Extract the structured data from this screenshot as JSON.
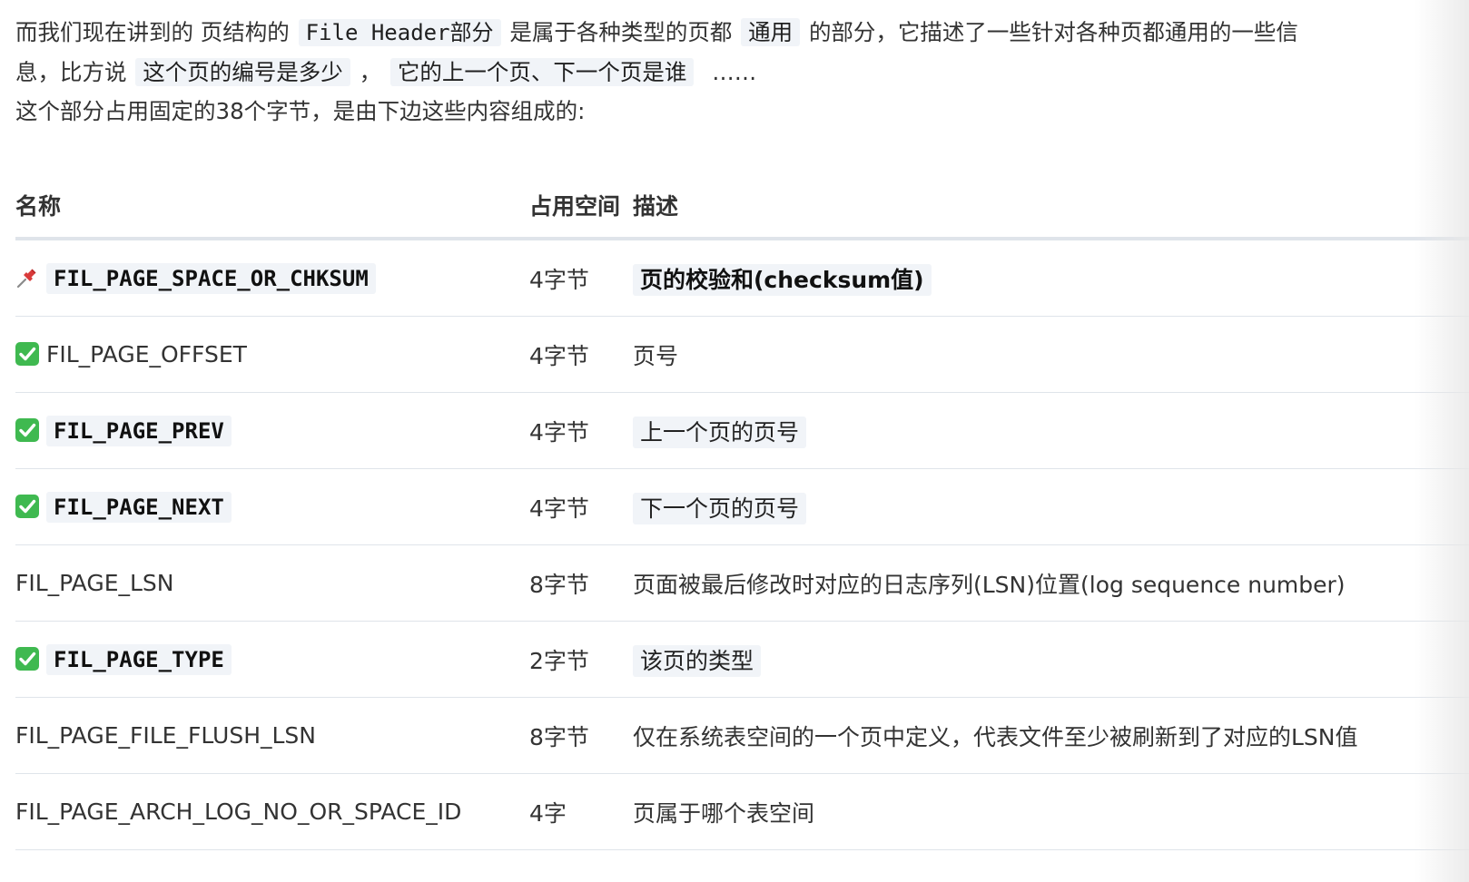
{
  "intro": {
    "line1": {
      "t1": "而我们现在讲到的 页结构的",
      "c1": "File Header部分",
      "t2": "是属于各种类型的页都",
      "c2": "通用",
      "t3": "的部分，它描述了一些针对各种页都通用的一些信"
    },
    "line2": {
      "t1": "息，比方说",
      "c1": "这个页的编号是多少",
      "t2": "，",
      "c2": "它的上一个页、下一个页是谁",
      "t3": "……"
    },
    "line3": "这个部分占用固定的38个字节，是由下边这些内容组成的:"
  },
  "table": {
    "headers": [
      "名称",
      "占用空间",
      "描述"
    ],
    "rows": [
      {
        "icon": "pushpin-icon",
        "name": "FIL_PAGE_SPACE_OR_CHKSUM",
        "name_style": "code-bold",
        "size": "4字节",
        "desc": "页的校验和(checksum值)",
        "desc_style": "bold"
      },
      {
        "icon": "check-mark-icon",
        "name": "FIL_PAGE_OFFSET",
        "name_style": "plain",
        "size": "4字节",
        "desc": "页号",
        "desc_style": "plain"
      },
      {
        "icon": "check-mark-icon",
        "name": "FIL_PAGE_PREV",
        "name_style": "code-bold",
        "size": "4字节",
        "desc": "上一个页的页号",
        "desc_style": "highlight"
      },
      {
        "icon": "check-mark-icon",
        "name": "FIL_PAGE_NEXT",
        "name_style": "code-bold",
        "size": "4字节",
        "desc": "下一个页的页号",
        "desc_style": "highlight"
      },
      {
        "icon": "",
        "name": "FIL_PAGE_LSN",
        "name_style": "plain",
        "size": "8字节",
        "desc": "页面被最后修改时对应的日志序列(LSN)位置(log sequence number)",
        "desc_style": "plain"
      },
      {
        "icon": "check-mark-icon",
        "name": "FIL_PAGE_TYPE",
        "name_style": "code-bold",
        "size": "2字节",
        "desc": "该页的类型",
        "desc_style": "highlight"
      },
      {
        "icon": "",
        "name": "FIL_PAGE_FILE_FLUSH_LSN",
        "name_style": "plain",
        "size": "8字节",
        "desc": "仅在系统表空间的一个页中定义，代表文件至少被刷新到了对应的LSN值",
        "desc_style": "plain"
      },
      {
        "icon": "",
        "name": "FIL_PAGE_ARCH_LOG_NO_OR_SPACE_ID",
        "name_style": "plain",
        "size": "4字",
        "desc": "页属于哪个表空间",
        "desc_style": "plain"
      }
    ]
  },
  "colors": {
    "highlight_bg": "#f1f4f8",
    "check_green": "#3fb950",
    "pin_red": "#d93a3a",
    "border": "#dfe4ea"
  }
}
